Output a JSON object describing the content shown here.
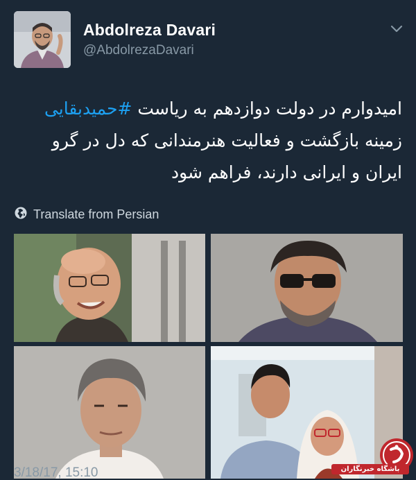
{
  "author": {
    "display_name": "Abdolreza Davari",
    "handle": "@AbdolrezaDavari"
  },
  "tweet": {
    "line1_prefix": "امیدوارم در دولت دوازدهم به ریاست ",
    "hashtag": "#حمیدبقایی",
    "line2": "زمینه بازگشت و فعالیت هنرمندانی که دل در گرو",
    "line3": "ایران و ایرانی دارند، فراهم شود"
  },
  "translate": {
    "label": "Translate from Persian",
    "icon": "globe-icon"
  },
  "media": {
    "count": 4,
    "photos": [
      "portrait-smiling-bald-man",
      "portrait-man-with-glasses",
      "portrait-gray-haired-man",
      "portrait-man-and-elderly-woman"
    ]
  },
  "timestamp": "3/18/17, 15:10",
  "watermark": {
    "text": "باشگاه خبرنگاران",
    "color": "#c0272d"
  },
  "colors": {
    "background": "#1b2836",
    "text": "#ffffff",
    "muted": "#8899a6",
    "hashtag": "#1da1f2"
  }
}
